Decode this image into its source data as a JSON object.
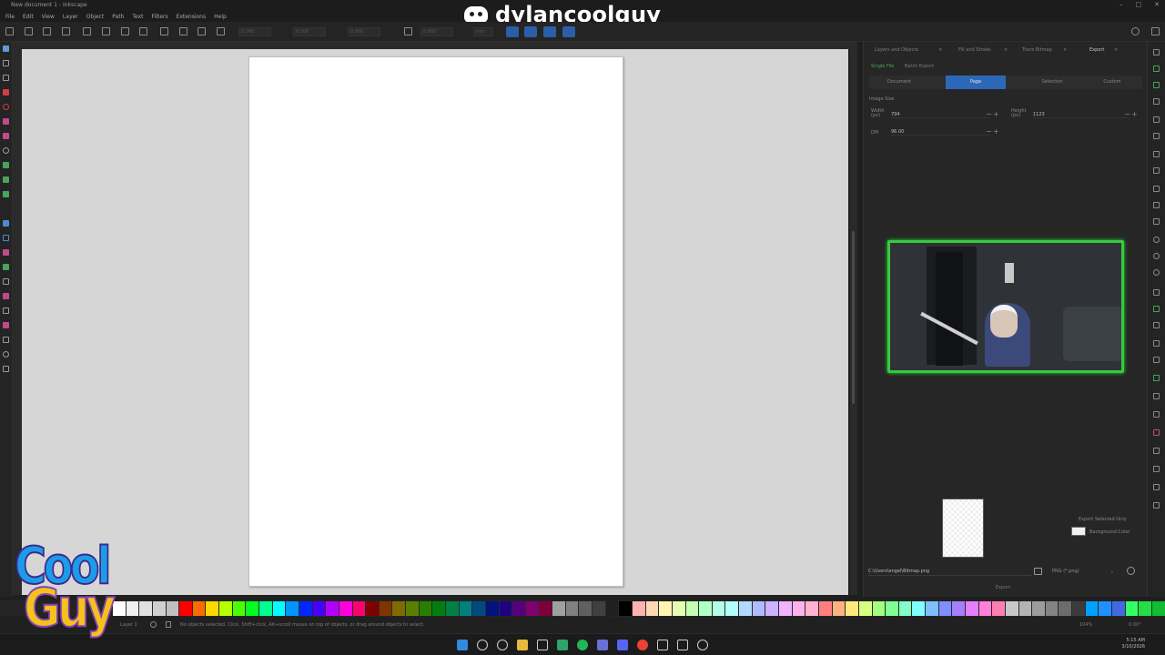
{
  "window": {
    "title": "New document 1 - Inkscape",
    "controls": [
      "–",
      "□",
      "✕"
    ]
  },
  "watermark": {
    "username": "dylancoolguy_"
  },
  "menu": [
    "File",
    "Edit",
    "View",
    "Layer",
    "Object",
    "Path",
    "Text",
    "Filters",
    "Extensions",
    "Help"
  ],
  "toolbar": {
    "units": "mm",
    "coord_placeholder": "0.000"
  },
  "dock": {
    "tabs": [
      "Layers and Objects",
      "Fill and Stroke",
      "Trace Bitmap",
      "Export"
    ],
    "active_tab": "Export",
    "subtabs": [
      "Single File",
      "Batch Export"
    ],
    "segments": [
      "Document",
      "Page",
      "Selection",
      "Custom"
    ],
    "selected_segment": "Page",
    "image_size_label": "Image Size",
    "width_label": "Width (px)",
    "width_value": "794",
    "height_label": "Height (px)",
    "height_value": "1123",
    "dpi_label": "DPI",
    "dpi_value": "96.00",
    "export_selected_only": "Export Selected Only",
    "background_color": "Background Color",
    "filename": "C:\\Users\\engel\\Bitmap.png",
    "format": "PNG (*.png)",
    "export_button": "Export"
  },
  "status": {
    "layer": "Layer 1",
    "message": "No objects selected. Click, Shift+click, Alt+scroll mouse on top of objects, or drag around objects to select.",
    "zoom": "104%",
    "rotation": "0.00°"
  },
  "taskbar": {
    "time": "5:15 AM",
    "date": "3/10/2026"
  },
  "logo": {
    "line1": "Cool",
    "line2": "Guy"
  },
  "colors": {
    "accent": "#2d68b8",
    "webcam_border": "#39c93e",
    "canvas": "#d6d6d6"
  }
}
